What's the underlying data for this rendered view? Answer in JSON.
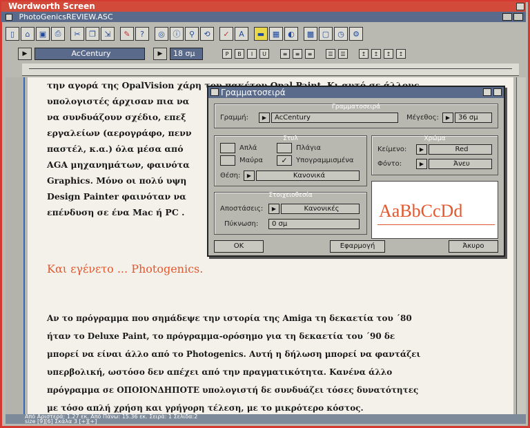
{
  "app": {
    "title": "Wordworth Screen",
    "document": "PhotoGenicsREVIEW.ASC"
  },
  "toolbar": {
    "font_name": "AcCentury",
    "font_size": "18 σμ"
  },
  "document": {
    "paragraph1": [
      "την αγορά της OpalVision χάρη του πακέτου Opal Paint. Κι αυτό σε άλλους",
      "υπολογιστές άρχισαν πια να",
      "να συνδυάζουν σχέδιο, επεξ",
      "εργαλείων (αερογράφο, πενν",
      "παστέλ, κ.α.) όλα μέσα από ",
      "AGA μηχανημάτων, φαινότα",
      "Graphics. Μόνο οι πολύ υψη",
      "Design Painter φαινόταν να",
      "επένδυση σε ένα Mac ή PC ."
    ],
    "heading": "Και εγένετο ... Photogenics.",
    "paragraph2": [
      "Αν το πρόγραμμα που σημάδεψε την ιστορία της Amiga τη δεκαετία του ΄80",
      "ήταν το Deluxe Paint, το πρόγραμμα-ορόσημο για τη δεκαετία του ΄90 δε",
      "μπορεί να είναι άλλο από το Photogenics. Αυτή η δήλωση μπορεί να φαντάζει",
      "υπερβολική, ωστόσο δεν απέχει από την πραγματικότητα. Κανένα άλλο",
      "πρόγραμμα σε ΟΠΟΙΟΝΔΗΠΟΤΕ υπολογιστή δε συνδυάζει τόσες δυνατότητες",
      "με τόσο απλή χρήση και γρήγορη τέλεση, με το μικρότερο κόστος."
    ]
  },
  "status": {
    "line1": "Από Αριστερά: 1.27 εκ.  Από Πάνω: 15.36 εκ.  Σειρά: 1  Σελίδα:2",
    "line2": "size  [9][6]  Σκάλα  3  [+][+]"
  },
  "dialog": {
    "title": "Γραμματοσειρά",
    "font_group": "Γραμματοσειρά",
    "font_label": "Γραμμή:",
    "font_value": "AcCentury",
    "size_label": "Μέγεθος:",
    "size_value": "36 σμ",
    "style_group": "Στυλ",
    "style_normal": "Απλά",
    "style_italic": "Πλάγια",
    "style_bold": "Μαύρα",
    "style_underline": "Υπογραμμισμένα",
    "position_label": "Θέση:",
    "position_value": "Κανονικά",
    "color_group": "Χρώμα",
    "text_label": "Κείμενο:",
    "text_color": "Red",
    "bg_label": "Φόντο:",
    "bg_color": "Άνευ",
    "spacing_group": "Στοιχειοθεσία",
    "spacing_label": "Αποστάσεις:",
    "spacing_value": "Κανονικές",
    "density_label": "Πύκνωση:",
    "density_value": "0 σμ",
    "preview": "AaBbCcDd",
    "ok": "OK",
    "apply": "Εφαρμογή",
    "cancel": "Άκυρο"
  },
  "colors": {
    "accent": "#e2572c",
    "title": "#d24a3a",
    "field": "#5a6a8a"
  }
}
